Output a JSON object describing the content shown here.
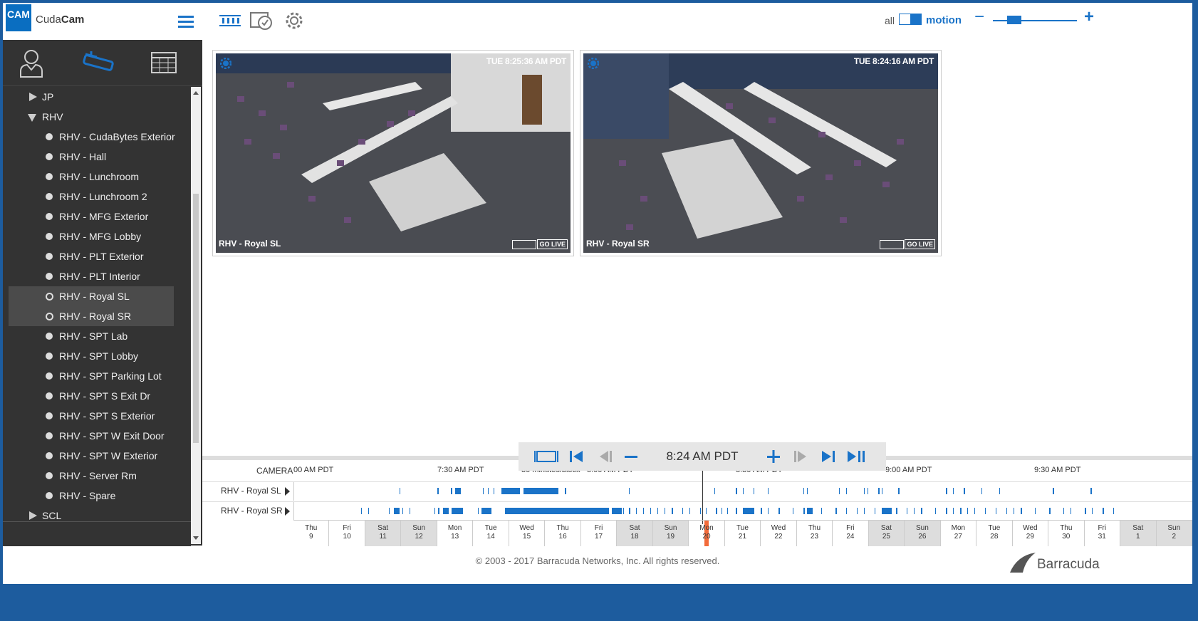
{
  "app": {
    "logo": "CAM",
    "brand_light": "Cuda",
    "brand_bold": "Cam"
  },
  "toolbar": {
    "all_label": "all",
    "motion_label": "motion",
    "zoom_minus": "−",
    "zoom_plus": "+"
  },
  "tree": {
    "items": [
      {
        "type": "group",
        "label": "JP",
        "expanded": false
      },
      {
        "type": "group",
        "label": "RHV",
        "expanded": true
      },
      {
        "type": "cam",
        "label": "RHV - CudaBytes Exterior"
      },
      {
        "type": "cam",
        "label": "RHV - Hall"
      },
      {
        "type": "cam",
        "label": "RHV - Lunchroom"
      },
      {
        "type": "cam",
        "label": "RHV - Lunchroom 2"
      },
      {
        "type": "cam",
        "label": "RHV - MFG Exterior"
      },
      {
        "type": "cam",
        "label": "RHV - MFG Lobby"
      },
      {
        "type": "cam",
        "label": "RHV - PLT Exterior"
      },
      {
        "type": "cam",
        "label": "RHV - PLT Interior"
      },
      {
        "type": "cam",
        "label": "RHV - Royal SL",
        "selected": true
      },
      {
        "type": "cam",
        "label": "RHV - Royal SR",
        "selected": true
      },
      {
        "type": "cam",
        "label": "RHV - SPT Lab"
      },
      {
        "type": "cam",
        "label": "RHV - SPT Lobby"
      },
      {
        "type": "cam",
        "label": "RHV - SPT Parking Lot"
      },
      {
        "type": "cam",
        "label": "RHV - SPT S Exit Dr"
      },
      {
        "type": "cam",
        "label": "RHV - SPT S Exterior"
      },
      {
        "type": "cam",
        "label": "RHV - SPT W Exit Door"
      },
      {
        "type": "cam",
        "label": "RHV - SPT W Exterior"
      },
      {
        "type": "cam",
        "label": "RHV - Server Rm"
      },
      {
        "type": "cam",
        "label": "RHV - Spare"
      },
      {
        "type": "group",
        "label": "SCL",
        "expanded": false
      }
    ]
  },
  "viewers": [
    {
      "name": "RHV - Royal SL",
      "timestamp": "TUE 8:25:36 AM PDT",
      "go_live": "GO LIVE"
    },
    {
      "name": "RHV - Royal SR",
      "timestamp": "TUE 8:24:16 AM PDT",
      "go_live": "GO LIVE"
    }
  ],
  "playback": {
    "time": "8:24 AM PDT"
  },
  "timeline": {
    "camera_header": "CAMERA",
    "time_labels": [
      "00 AM PDT",
      "7:30 AM PDT",
      "30 minutes/block",
      "8:00 AM PDT",
      "8:30 AM PDT",
      "9:00 AM PDT",
      "9:30 AM PDT"
    ],
    "rows": [
      {
        "label": "RHV - Royal SL"
      },
      {
        "label": "RHV - Royal SR"
      }
    ],
    "days": [
      {
        "d": "Thu",
        "n": "9",
        "we": false
      },
      {
        "d": "Fri",
        "n": "10",
        "we": false
      },
      {
        "d": "Sat",
        "n": "11",
        "we": true
      },
      {
        "d": "Sun",
        "n": "12",
        "we": true
      },
      {
        "d": "Mon",
        "n": "13",
        "we": false
      },
      {
        "d": "Tue",
        "n": "14",
        "we": false
      },
      {
        "d": "Wed",
        "n": "15",
        "we": false
      },
      {
        "d": "Thu",
        "n": "16",
        "we": false
      },
      {
        "d": "Fri",
        "n": "17",
        "we": false
      },
      {
        "d": "Sat",
        "n": "18",
        "we": true
      },
      {
        "d": "Sun",
        "n": "19",
        "we": true
      },
      {
        "d": "Mon",
        "n": "20",
        "we": false
      },
      {
        "d": "Tue",
        "n": "21",
        "we": false
      },
      {
        "d": "Wed",
        "n": "22",
        "we": false
      },
      {
        "d": "Thu",
        "n": "23",
        "we": false
      },
      {
        "d": "Fri",
        "n": "24",
        "we": false
      },
      {
        "d": "Sat",
        "n": "25",
        "we": true
      },
      {
        "d": "Sun",
        "n": "26",
        "we": true
      },
      {
        "d": "Mon",
        "n": "27",
        "we": false
      },
      {
        "d": "Tue",
        "n": "28",
        "we": false
      },
      {
        "d": "Wed",
        "n": "29",
        "we": false
      },
      {
        "d": "Thu",
        "n": "30",
        "we": false
      },
      {
        "d": "Fri",
        "n": "31",
        "we": false
      },
      {
        "d": "Sat",
        "n": "1",
        "we": true
      },
      {
        "d": "Sun",
        "n": "2",
        "we": true
      }
    ]
  },
  "footer": {
    "copyright": "© 2003 - 2017 Barracuda Networks, Inc. All rights reserved.",
    "brand": "Barracuda"
  },
  "colors": {
    "accent": "#1a73c8",
    "sidebar": "#333333",
    "today": "#f26b3a"
  }
}
